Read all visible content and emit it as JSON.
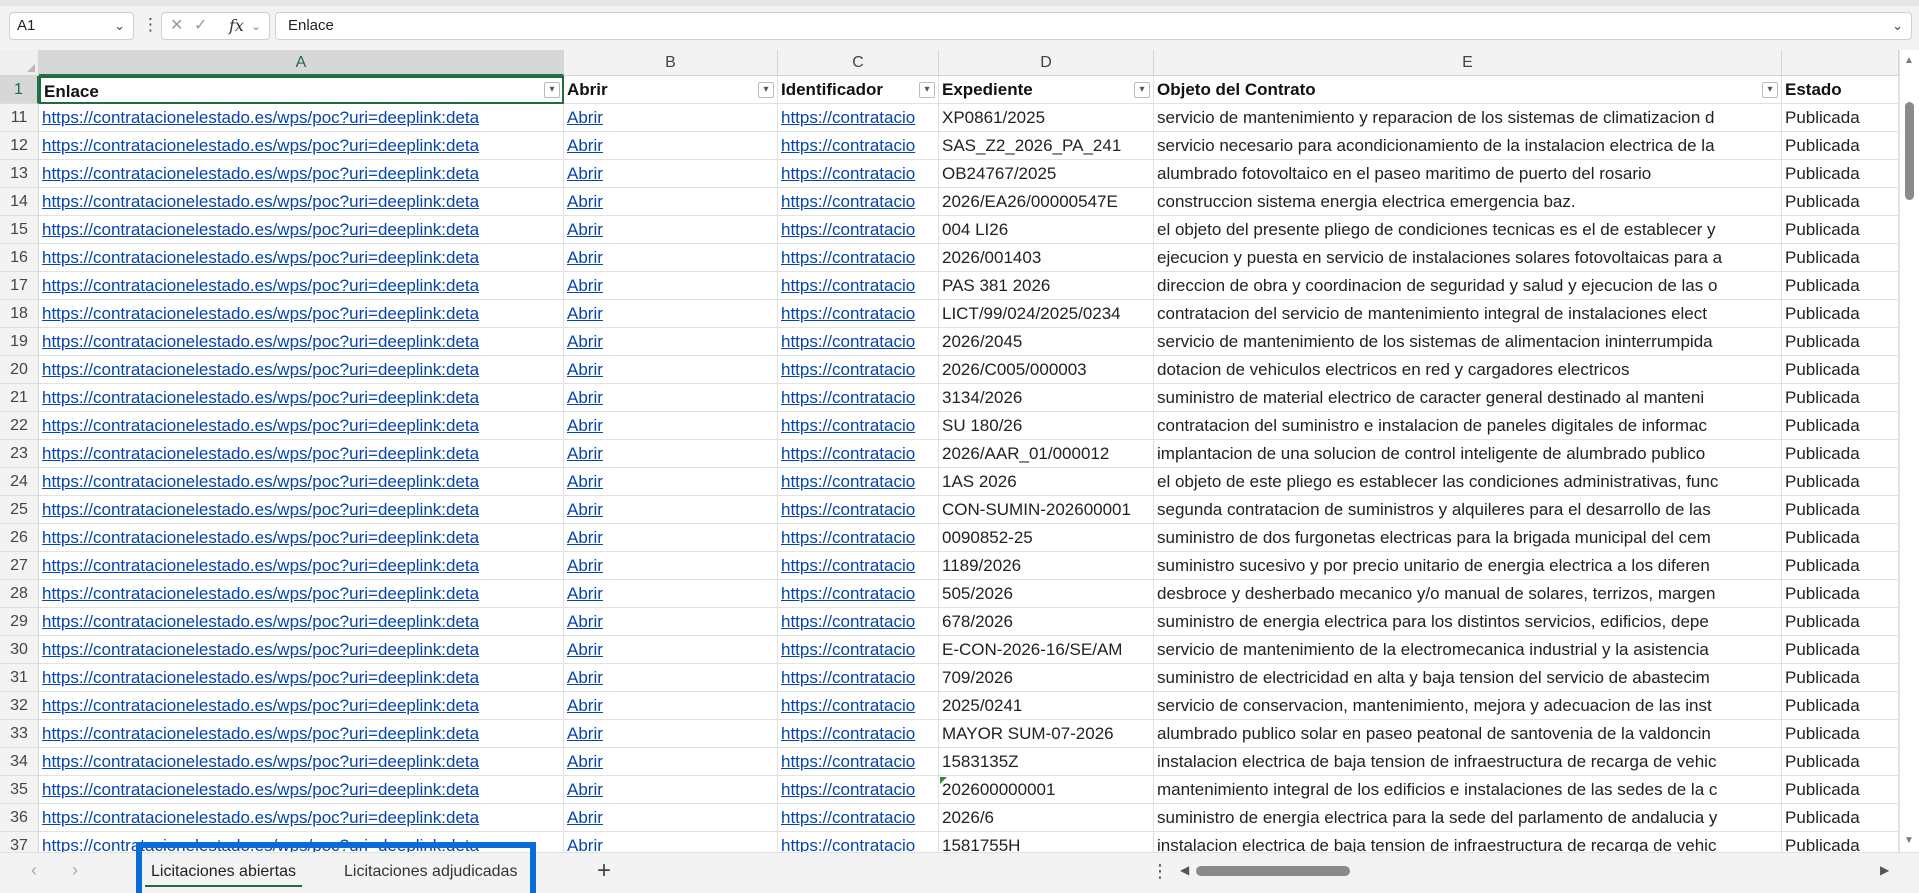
{
  "formula_bar": {
    "name_box": "A1",
    "name_box_chevron": "chevron-down-icon",
    "cancel_glyph": "✕",
    "enter_glyph": "✓",
    "fx_label": "fx",
    "formula_content": "Enlace"
  },
  "columns": [
    "A",
    "B",
    "C",
    "D",
    "E"
  ],
  "header_row": {
    "number": "1",
    "cells": [
      "Enlace",
      "Abrir",
      "Identificador",
      "Expediente",
      "Objeto del Contrato",
      "Estado"
    ]
  },
  "rows": [
    {
      "num": "11",
      "enlace": "https://contratacionelestado.es/wps/poc?uri=deeplink:deta",
      "abrir": "Abrir",
      "id": "https://contratacio",
      "exp": "XP0861/2025",
      "obj": "servicio de mantenimiento y reparacion de los sistemas de climatizacion d",
      "estado": "Publicada"
    },
    {
      "num": "12",
      "enlace": "https://contratacionelestado.es/wps/poc?uri=deeplink:deta",
      "abrir": "Abrir",
      "id": "https://contratacio",
      "exp": "SAS_Z2_2026_PA_241",
      "obj": "servicio necesario para acondicionamiento de la instalacion electrica de la",
      "estado": "Publicada"
    },
    {
      "num": "13",
      "enlace": "https://contratacionelestado.es/wps/poc?uri=deeplink:deta",
      "abrir": "Abrir",
      "id": "https://contratacio",
      "exp": "OB24767/2025",
      "obj": "alumbrado fotovoltaico en el paseo maritimo de puerto del rosario",
      "estado": "Publicada"
    },
    {
      "num": "14",
      "enlace": "https://contratacionelestado.es/wps/poc?uri=deeplink:deta",
      "abrir": "Abrir",
      "id": "https://contratacio",
      "exp": "2026/EA26/00000547E",
      "obj": "construccion sistema energia electrica emergencia baz.",
      "estado": "Publicada"
    },
    {
      "num": "15",
      "enlace": "https://contratacionelestado.es/wps/poc?uri=deeplink:deta",
      "abrir": "Abrir",
      "id": "https://contratacio",
      "exp": "004 LI26",
      "obj": "el objeto del presente pliego de condiciones tecnicas es el de establecer y",
      "estado": "Publicada"
    },
    {
      "num": "16",
      "enlace": "https://contratacionelestado.es/wps/poc?uri=deeplink:deta",
      "abrir": "Abrir",
      "id": "https://contratacio",
      "exp": "2026/001403",
      "obj": "ejecucion y puesta en servicio de instalaciones solares fotovoltaicas para a",
      "estado": "Publicada"
    },
    {
      "num": "17",
      "enlace": "https://contratacionelestado.es/wps/poc?uri=deeplink:deta",
      "abrir": "Abrir",
      "id": "https://contratacio",
      "exp": "PAS 381 2026",
      "obj": "direccion de obra y coordinacion de seguridad y salud y ejecucion de las o",
      "estado": "Publicada"
    },
    {
      "num": "18",
      "enlace": "https://contratacionelestado.es/wps/poc?uri=deeplink:deta",
      "abrir": "Abrir",
      "id": "https://contratacio",
      "exp": "LICT/99/024/2025/0234",
      "obj": "contratacion del servicio de mantenimiento integral de instalaciones elect",
      "estado": "Publicada"
    },
    {
      "num": "19",
      "enlace": "https://contratacionelestado.es/wps/poc?uri=deeplink:deta",
      "abrir": "Abrir",
      "id": "https://contratacio",
      "exp": "2026/2045",
      "obj": "servicio de mantenimiento de los sistemas de alimentacion ininterrumpida",
      "estado": "Publicada"
    },
    {
      "num": "20",
      "enlace": "https://contratacionelestado.es/wps/poc?uri=deeplink:deta",
      "abrir": "Abrir",
      "id": "https://contratacio",
      "exp": "2026/C005/000003",
      "obj": "dotacion de vehiculos electricos en red y cargadores electricos",
      "estado": "Publicada"
    },
    {
      "num": "21",
      "enlace": "https://contratacionelestado.es/wps/poc?uri=deeplink:deta",
      "abrir": "Abrir",
      "id": "https://contratacio",
      "exp": "3134/2026",
      "obj": "suministro de material electrico de caracter general destinado al manteni",
      "estado": "Publicada"
    },
    {
      "num": "22",
      "enlace": "https://contratacionelestado.es/wps/poc?uri=deeplink:deta",
      "abrir": "Abrir",
      "id": "https://contratacio",
      "exp": "SU 180/26",
      "obj": "contratacion del suministro e instalacion de paneles digitales de informac",
      "estado": "Publicada"
    },
    {
      "num": "23",
      "enlace": "https://contratacionelestado.es/wps/poc?uri=deeplink:deta",
      "abrir": "Abrir",
      "id": "https://contratacio",
      "exp": "2026/AAR_01/000012",
      "obj": "implantacion de una solucion de control inteligente de alumbrado publico",
      "estado": "Publicada"
    },
    {
      "num": "24",
      "enlace": "https://contratacionelestado.es/wps/poc?uri=deeplink:deta",
      "abrir": "Abrir",
      "id": "https://contratacio",
      "exp": "1AS 2026",
      "obj": "el objeto de este pliego es establecer las condiciones administrativas, func",
      "estado": "Publicada"
    },
    {
      "num": "25",
      "enlace": "https://contratacionelestado.es/wps/poc?uri=deeplink:deta",
      "abrir": "Abrir",
      "id": "https://contratacio",
      "exp": "CON-SUMIN-202600001",
      "obj": "segunda contratacion de suministros y alquileres para el desarrollo de las",
      "estado": "Publicada"
    },
    {
      "num": "26",
      "enlace": "https://contratacionelestado.es/wps/poc?uri=deeplink:deta",
      "abrir": "Abrir",
      "id": "https://contratacio",
      "exp": "0090852-25",
      "obj": "suministro de dos furgonetas electricas para la brigada municipal del cem",
      "estado": "Publicada"
    },
    {
      "num": "27",
      "enlace": "https://contratacionelestado.es/wps/poc?uri=deeplink:deta",
      "abrir": "Abrir",
      "id": "https://contratacio",
      "exp": "1189/2026",
      "obj": "suministro sucesivo y por precio unitario de energia electrica a los diferen",
      "estado": "Publicada"
    },
    {
      "num": "28",
      "enlace": "https://contratacionelestado.es/wps/poc?uri=deeplink:deta",
      "abrir": "Abrir",
      "id": "https://contratacio",
      "exp": "505/2026",
      "obj": "desbroce y desherbado mecanico y/o manual de solares, terrizos, margen",
      "estado": "Publicada"
    },
    {
      "num": "29",
      "enlace": "https://contratacionelestado.es/wps/poc?uri=deeplink:deta",
      "abrir": "Abrir",
      "id": "https://contratacio",
      "exp": "678/2026",
      "obj": "suministro de energia electrica para los distintos servicios, edificios, depe",
      "estado": "Publicada"
    },
    {
      "num": "30",
      "enlace": "https://contratacionelestado.es/wps/poc?uri=deeplink:deta",
      "abrir": "Abrir",
      "id": "https://contratacio",
      "exp": "E-CON-2026-16/SE/AM",
      "obj": "servicio de mantenimiento de la electromecanica industrial y la asistencia",
      "estado": "Publicada"
    },
    {
      "num": "31",
      "enlace": "https://contratacionelestado.es/wps/poc?uri=deeplink:deta",
      "abrir": "Abrir",
      "id": "https://contratacio",
      "exp": "709/2026",
      "obj": "suministro de electricidad en alta y baja tension del servicio de abastecim",
      "estado": "Publicada"
    },
    {
      "num": "32",
      "enlace": "https://contratacionelestado.es/wps/poc?uri=deeplink:deta",
      "abrir": "Abrir",
      "id": "https://contratacio",
      "exp": "2025/0241",
      "obj": "servicio de conservacion, mantenimiento, mejora y adecuacion de las inst",
      "estado": "Publicada"
    },
    {
      "num": "33",
      "enlace": "https://contratacionelestado.es/wps/poc?uri=deeplink:deta",
      "abrir": "Abrir",
      "id": "https://contratacio",
      "exp": "MAYOR SUM-07-2026",
      "obj": "alumbrado publico solar en paseo peatonal de santovenia de la valdoncin",
      "estado": "Publicada"
    },
    {
      "num": "34",
      "enlace": "https://contratacionelestado.es/wps/poc?uri=deeplink:deta",
      "abrir": "Abrir",
      "id": "https://contratacio",
      "exp": "1583135Z",
      "obj": "instalacion electrica de baja tension de infraestructura de recarga de vehic",
      "estado": "Publicada"
    },
    {
      "num": "35",
      "enlace": "https://contratacionelestado.es/wps/poc?uri=deeplink:deta",
      "abrir": "Abrir",
      "id": "https://contratacio",
      "exp": "202600000001",
      "obj": "mantenimiento integral de los edificios e instalaciones de las sedes de la c",
      "estado": "Publicada",
      "flag": true
    },
    {
      "num": "36",
      "enlace": "https://contratacionelestado.es/wps/poc?uri=deeplink:deta",
      "abrir": "Abrir",
      "id": "https://contratacio",
      "exp": "2026/6",
      "obj": "suministro de energia electrica para la sede del parlamento de andalucia y",
      "estado": "Publicada"
    },
    {
      "num": "37",
      "enlace": "https://contratacionelestado.es/wps/poc?uri=deeplink:deta",
      "abrir": "Abrir",
      "id": "https://contratacio",
      "exp": "1581755H",
      "obj": "instalacion electrica de baja tension de infraestructura de recarga de vehic",
      "estado": "Publicada"
    }
  ],
  "sheets": {
    "tabs": [
      "Licitaciones abiertas",
      "Licitaciones adjudicadas"
    ],
    "active_index": 0,
    "add_glyph": "+",
    "prev_glyph": "‹",
    "next_glyph": "›",
    "more_glyph": "⋮"
  },
  "accent_color": "#1e6c3f",
  "link_color": "#0645ad",
  "highlight_color": "#0a6bd6"
}
